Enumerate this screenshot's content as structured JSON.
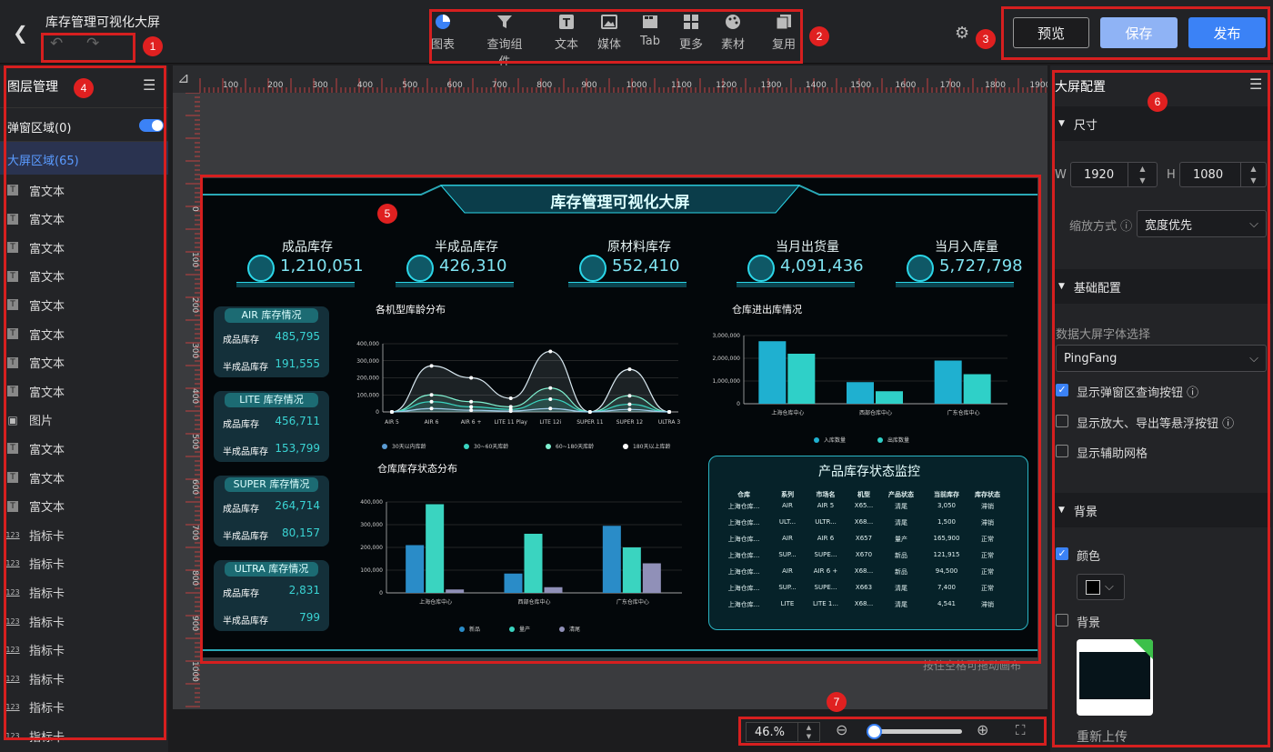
{
  "title": "库存管理可视化大屏",
  "toolbar": {
    "items": [
      {
        "label": "图表"
      },
      {
        "label": "查询组件"
      },
      {
        "label": "文本"
      },
      {
        "label": "媒体"
      },
      {
        "label": "Tab"
      },
      {
        "label": "更多"
      },
      {
        "label": "素材"
      },
      {
        "label": "复用"
      }
    ]
  },
  "actions": {
    "preview": "预览",
    "save": "保存",
    "publish": "发布"
  },
  "layers": {
    "title": "图层管理",
    "popup_area": "弹窗区域(0)",
    "screen_area": "大屏区域(65)",
    "items": [
      {
        "type": "T",
        "label": "富文本"
      },
      {
        "type": "T",
        "label": "富文本"
      },
      {
        "type": "T",
        "label": "富文本"
      },
      {
        "type": "T",
        "label": "富文本"
      },
      {
        "type": "T",
        "label": "富文本"
      },
      {
        "type": "T",
        "label": "富文本"
      },
      {
        "type": "T",
        "label": "富文本"
      },
      {
        "type": "T",
        "label": "富文本"
      },
      {
        "type": "img",
        "label": "图片"
      },
      {
        "type": "T",
        "label": "富文本"
      },
      {
        "type": "T",
        "label": "富文本"
      },
      {
        "type": "T",
        "label": "富文本"
      },
      {
        "type": "123",
        "label": "指标卡"
      },
      {
        "type": "123",
        "label": "指标卡"
      },
      {
        "type": "123",
        "label": "指标卡"
      },
      {
        "type": "123",
        "label": "指标卡"
      },
      {
        "type": "123",
        "label": "指标卡"
      },
      {
        "type": "123",
        "label": "指标卡"
      },
      {
        "type": "123",
        "label": "指标卡"
      },
      {
        "type": "123",
        "label": "指标卡"
      }
    ]
  },
  "ruler": {
    "h": [
      "100",
      "200",
      "300",
      "400",
      "500",
      "600",
      "700",
      "800",
      "900",
      "1000",
      "1100",
      "1200",
      "1300",
      "1400",
      "1500",
      "1600",
      "1700",
      "1800",
      "1900"
    ],
    "v": [
      "0",
      "100",
      "200",
      "300",
      "400",
      "500",
      "600",
      "700",
      "800",
      "900",
      "1000"
    ]
  },
  "dashboard": {
    "title": "库存管理可视化大屏",
    "kpis": [
      {
        "label": "成品库存",
        "value": "1,210,051"
      },
      {
        "label": "半成品库存",
        "value": "426,310"
      },
      {
        "label": "原材料库存",
        "value": "552,410"
      },
      {
        "label": "当月出货量",
        "value": "4,091,436"
      },
      {
        "label": "当月入库量",
        "value": "5,727,798"
      }
    ],
    "cards": [
      {
        "title": "AIR 库存情况",
        "r1": "成品库存",
        "v1": "485,795",
        "r2": "半成品库存",
        "v2": "191,555"
      },
      {
        "title": "LITE 库存情况",
        "r1": "成品库存",
        "v1": "456,711",
        "r2": "半成品库存",
        "v2": "153,799"
      },
      {
        "title": "SUPER 库存情况",
        "r1": "成品库存",
        "v1": "264,714",
        "r2": "半成品库存",
        "v2": "80,157"
      },
      {
        "title": "ULTRA 库存情况",
        "r1": "成品库存",
        "v1": "2,831",
        "r2": "半成品库存",
        "v2": "799"
      }
    ],
    "table": {
      "title": "产品库存状态监控",
      "headers": [
        "仓库",
        "系列",
        "市场名",
        "机型",
        "产品状态",
        "当前库存",
        "库存状态"
      ],
      "rows": [
        [
          "上海仓库...",
          "AIR",
          "AIR 5",
          "X65...",
          "清尾",
          "3,050",
          "滞销"
        ],
        [
          "上海仓库...",
          "ULT...",
          "ULTR...",
          "X68...",
          "清尾",
          "1,500",
          "滞销"
        ],
        [
          "上海仓库...",
          "AIR",
          "AIR 6",
          "X657",
          "量产",
          "165,900",
          "正常"
        ],
        [
          "上海仓库...",
          "SUP...",
          "SUPE...",
          "X670",
          "新品",
          "121,915",
          "正常"
        ],
        [
          "上海仓库...",
          "AIR",
          "AIR 6 +",
          "X68...",
          "新品",
          "94,500",
          "正常"
        ],
        [
          "上海仓库...",
          "SUP...",
          "SUPE...",
          "X663",
          "清尾",
          "7,400",
          "正常"
        ],
        [
          "上海仓库...",
          "LITE",
          "LITE 1...",
          "X68...",
          "清尾",
          "4,541",
          "滞销"
        ]
      ]
    }
  },
  "chart_data": [
    {
      "type": "area",
      "title": "各机型库龄分布",
      "categories": [
        "AIR 5",
        "AIR 6",
        "AIR 6 +",
        "LITE 11 Play",
        "LITE 12i",
        "SUPER 11",
        "SUPER 12",
        "ULTRA 3"
      ],
      "yticks": [
        "400,000",
        "300,000",
        "200,000",
        "100,000",
        "0"
      ],
      "ylim": [
        0,
        400000
      ],
      "series": [
        {
          "name": "30天以内库龄",
          "values": [
            0,
            270000,
            200000,
            80000,
            355000,
            0,
            250000,
            0
          ]
        },
        {
          "name": "30~60天库龄",
          "values": [
            0,
            100000,
            60000,
            30000,
            140000,
            0,
            95000,
            0
          ]
        },
        {
          "name": "60~180天库龄",
          "values": [
            0,
            60000,
            30000,
            15000,
            75000,
            0,
            45000,
            0
          ]
        },
        {
          "name": "180天以上库龄",
          "values": [
            0,
            20000,
            10000,
            5000,
            20000,
            0,
            15000,
            0
          ]
        }
      ]
    },
    {
      "type": "bar",
      "title": "仓库进出库情况",
      "categories": [
        "上海仓库中心",
        "西部仓库中心",
        "广东仓库中心"
      ],
      "yticks": [
        "3,000,000",
        "2,000,000",
        "1,000,000",
        "0"
      ],
      "ylim": [
        0,
        3000000
      ],
      "series": [
        {
          "name": "入库数量",
          "values": [
            2750000,
            950000,
            1900000
          ]
        },
        {
          "name": "出库数量",
          "values": [
            2200000,
            550000,
            1300000
          ]
        }
      ]
    },
    {
      "type": "bar",
      "title": "仓库库存状态分布",
      "categories": [
        "上海仓库中心",
        "西部仓库中心",
        "广东仓库中心"
      ],
      "yticks": [
        "400,000",
        "300,000",
        "200,000",
        "100,000",
        "0"
      ],
      "ylim": [
        0,
        400000
      ],
      "series": [
        {
          "name": "新品",
          "values": [
            210000,
            85000,
            295000
          ]
        },
        {
          "name": "量产",
          "values": [
            390000,
            260000,
            200000
          ]
        },
        {
          "name": "清尾",
          "values": [
            15000,
            25000,
            130000
          ]
        }
      ]
    }
  ],
  "hint": "按住空格可拖动画布",
  "config": {
    "title": "大屏配置",
    "size_section": "尺寸",
    "w_label": "W",
    "w": "1920",
    "h_label": "H",
    "h": "1080",
    "scale_label": "缩放方式",
    "scale_value": "宽度优先",
    "basic_section": "基础配置",
    "font_label": "数据大屏字体选择",
    "font_value": "PingFang",
    "opt1": "显示弹窗区查询按钮",
    "opt2": "显示放大、导出等悬浮按钮",
    "opt3": "显示辅助网格",
    "bg_section": "背景",
    "color_label": "颜色",
    "bg_label": "背景",
    "reupload": "重新上传"
  },
  "zoom": {
    "value": "46.%",
    "level": 0.08
  },
  "markers": [
    "1",
    "2",
    "3",
    "4",
    "5",
    "6",
    "7"
  ],
  "colors": {
    "accent": "#3b82f6",
    "save": "#8fb3f5",
    "teal": "#3ad4d4"
  }
}
